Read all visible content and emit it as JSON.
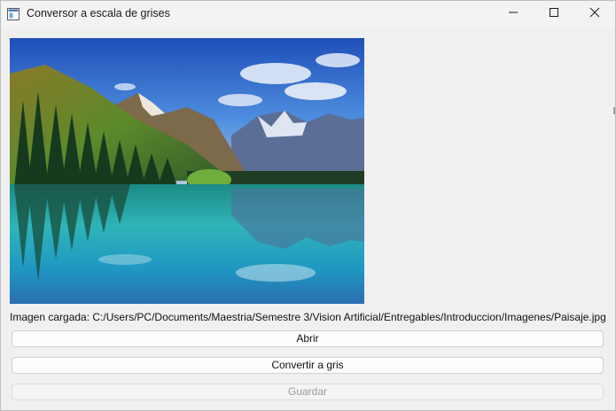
{
  "window": {
    "title": "Conversor a escala de grises",
    "icons": {
      "app": "app-window-icon",
      "minimize": "minimize-icon",
      "maximize": "maximize-icon",
      "close": "close-icon"
    }
  },
  "main": {
    "image_alt": "Paisaje",
    "status_text": "Imagen cargada: C:/Users/PC/Documents/Maestria/Semestre 3/Vision Artificial/Entregables/Introduccion/Imagenes/Paisaje.jpg",
    "buttons": {
      "open": "Abrir",
      "convert": "Convertir a gris",
      "save": "Guardar"
    }
  },
  "colors": {
    "window_bg": "#f0f0f0",
    "titlebar_bg": "#f3f3f3",
    "button_bg": "#fdfdfd",
    "disabled_text": "#9a9a9a"
  }
}
